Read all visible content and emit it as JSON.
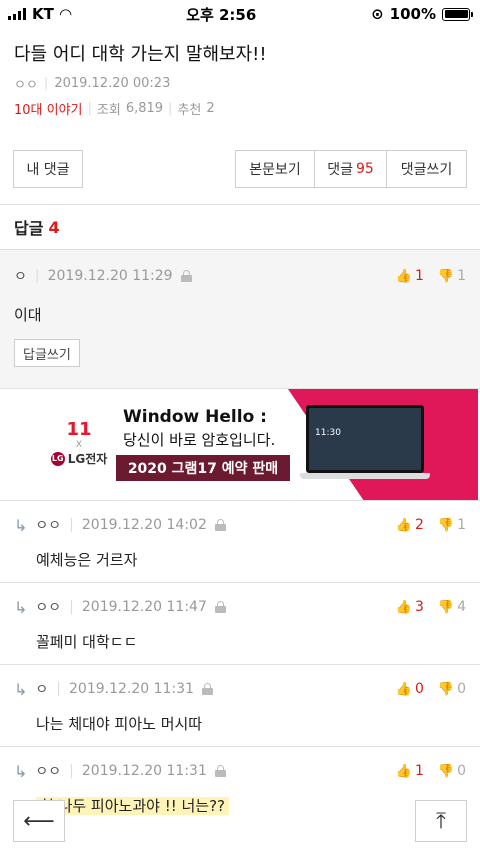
{
  "status": {
    "carrier": "KT",
    "time": "오후 2:56",
    "battery": "100%"
  },
  "post": {
    "title": "다들 어디 대학 가는지 말해보자!!",
    "author": "ㅇㅇ",
    "date": "2019.12.20 00:23",
    "board": "10대 이야기",
    "views_label": "조회",
    "views": "6,819",
    "likes_label": "추천",
    "likes": "2"
  },
  "buttons": {
    "my_comments": "내 댓글",
    "view_post": "본문보기",
    "comments_label": "댓글",
    "comments_count": "95",
    "write_comment": "댓글쓰기"
  },
  "replies_header": {
    "label": "답글",
    "count": "4"
  },
  "main_comment": {
    "author": "ㅇ",
    "date": "2019.12.20 11:29",
    "up": "1",
    "down": "1",
    "text": "이대",
    "reply_button": "답글쓰기"
  },
  "ad": {
    "brand1": "11",
    "brand_x": "X",
    "brand2": "LG전자",
    "headline": "Window Hello :",
    "sub": "당신이 바로 암호입니다.",
    "cta": "2020 그램17 예약 판매",
    "screen_time": "11:30"
  },
  "replies": [
    {
      "author": "ㅇㅇ",
      "date": "2019.12.20 14:02",
      "up": "2",
      "down": "1",
      "text": "예체능은 거르자"
    },
    {
      "author": "ㅇㅇ",
      "date": "2019.12.20 11:47",
      "up": "3",
      "down": "4",
      "text": "꼴페미 대학ㄷㄷ"
    },
    {
      "author": "ㅇ",
      "date": "2019.12.20 11:31",
      "up": "0",
      "down": "0",
      "text": "나는 체대야 피아노 머시따"
    },
    {
      "author": "ㅇㅇ",
      "date": "2019.12.20 11:31",
      "up": "1",
      "down": "0",
      "text": "헐 나두 피아노과야 !! 너는??"
    }
  ],
  "icons": {
    "back": "arrow-left-icon",
    "top": "arrow-up-to-top-icon",
    "up": "thumbs-up-icon",
    "down": "thumbs-down-icon",
    "lock": "lock-icon",
    "reply": "reply-arrow-icon"
  },
  "colors": {
    "accent": "#d91b1b",
    "ad_pink": "#e0185a"
  }
}
